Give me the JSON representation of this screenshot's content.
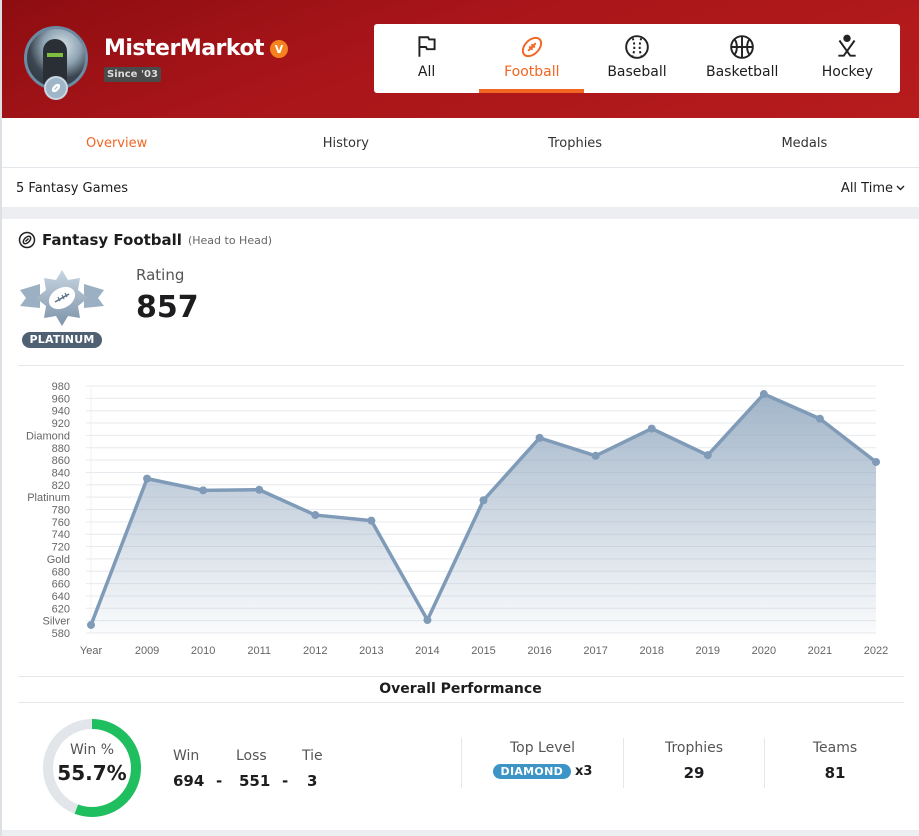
{
  "profile": {
    "username": "MisterMarkot",
    "vip_badge": "V",
    "since": "Since '03"
  },
  "sport_tabs": [
    {
      "label": "All",
      "icon": "flag-icon",
      "active": false
    },
    {
      "label": "Football",
      "icon": "football-icon",
      "active": true
    },
    {
      "label": "Baseball",
      "icon": "baseball-icon",
      "active": false
    },
    {
      "label": "Basketball",
      "icon": "basketball-icon",
      "active": false
    },
    {
      "label": "Hockey",
      "icon": "hockey-icon",
      "active": false
    }
  ],
  "subnav": [
    {
      "label": "Overview",
      "active": true
    },
    {
      "label": "History",
      "active": false
    },
    {
      "label": "Trophies",
      "active": false
    },
    {
      "label": "Medals",
      "active": false
    }
  ],
  "games_bar": {
    "count_label": "5 Fantasy Games",
    "filter_label": "All Time"
  },
  "section": {
    "title": "Fantasy Football",
    "subtitle": "(Head to Head)",
    "tier_label": "PLATINUM",
    "rating_label": "Rating",
    "rating_value": "857"
  },
  "colors": {
    "accent": "#f26522",
    "hero": "#a8151a",
    "chart_line": "#7f9bb8",
    "win_ring": "#1fbf5f",
    "diamond": "#3d95c7"
  },
  "chart_data": {
    "type": "area",
    "title": "",
    "xlabel": "",
    "ylabel": "",
    "categories": [
      "Year",
      "2009",
      "2010",
      "2011",
      "2012",
      "2013",
      "2014",
      "2015",
      "2016",
      "2017",
      "2018",
      "2019",
      "2020",
      "2021",
      "2022"
    ],
    "values": [
      593,
      830,
      811,
      812,
      771,
      762,
      601,
      795,
      896,
      867,
      911,
      868,
      967,
      927,
      857
    ],
    "ylim": [
      580,
      980
    ],
    "y_ticks": [
      {
        "value": 980,
        "label": "980"
      },
      {
        "value": 960,
        "label": "960"
      },
      {
        "value": 940,
        "label": "940"
      },
      {
        "value": 920,
        "label": "920"
      },
      {
        "value": 900,
        "label": "Diamond"
      },
      {
        "value": 880,
        "label": "880"
      },
      {
        "value": 860,
        "label": "860"
      },
      {
        "value": 840,
        "label": "840"
      },
      {
        "value": 820,
        "label": "820"
      },
      {
        "value": 800,
        "label": "Platinum"
      },
      {
        "value": 780,
        "label": "780"
      },
      {
        "value": 760,
        "label": "760"
      },
      {
        "value": 740,
        "label": "740"
      },
      {
        "value": 720,
        "label": "720"
      },
      {
        "value": 700,
        "label": "Gold"
      },
      {
        "value": 680,
        "label": "680"
      },
      {
        "value": 660,
        "label": "660"
      },
      {
        "value": 640,
        "label": "640"
      },
      {
        "value": 620,
        "label": "620"
      },
      {
        "value": 600,
        "label": "Silver"
      },
      {
        "value": 580,
        "label": "580"
      }
    ],
    "grid": true,
    "legend": "none"
  },
  "performance": {
    "title": "Overall Performance",
    "win_pct_label": "Win %",
    "win_pct_value": "55.7%",
    "win_fraction": 0.557,
    "win_label": "Win",
    "loss_label": "Loss",
    "tie_label": "Tie",
    "wins": "694",
    "losses": "551",
    "ties": "3",
    "separator": "-",
    "top_level_label": "Top Level",
    "top_level_value": "DIAMOND",
    "top_level_count": "x3",
    "trophies_label": "Trophies",
    "trophies_value": "29",
    "teams_label": "Teams",
    "teams_value": "81"
  }
}
